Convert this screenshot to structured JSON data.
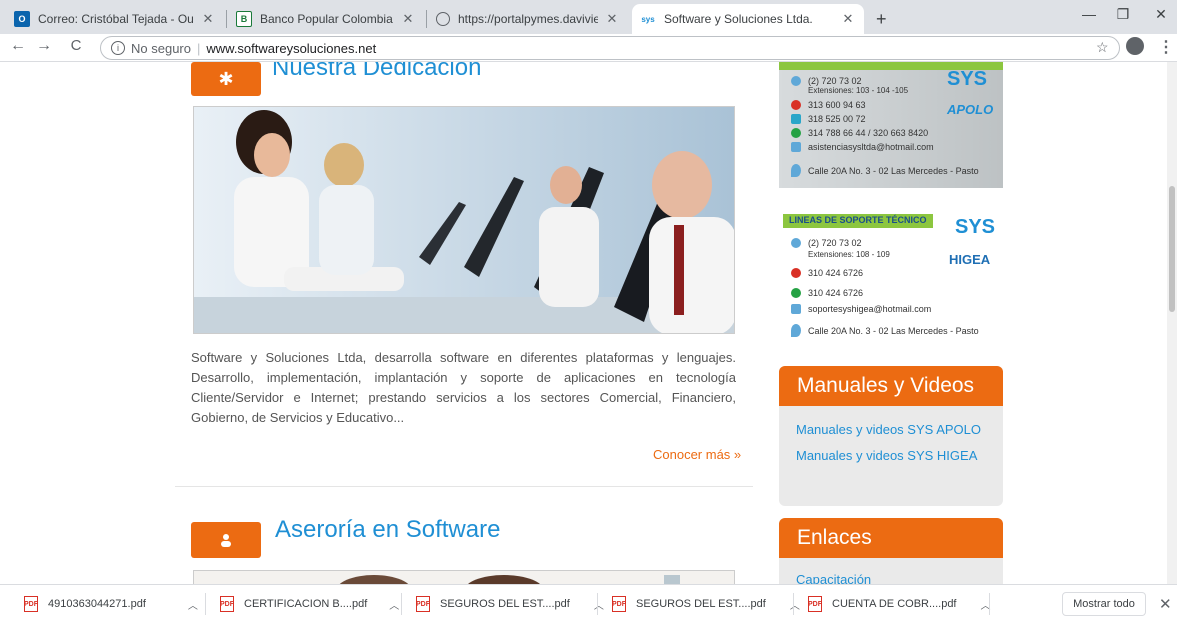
{
  "tabs": [
    {
      "title": "Correo: Cristóbal Tejada - Outloo",
      "favicon": "outlook-icon"
    },
    {
      "title": "Banco Popular Colombia",
      "favicon": "banco-popular-icon"
    },
    {
      "title": "https://portalpymes.davivienda.c",
      "favicon": "globe-icon"
    },
    {
      "title": "Software y Soluciones Ltda.",
      "favicon": "sys-icon"
    }
  ],
  "omnibox": {
    "security": "No seguro",
    "separator": "|",
    "url": "www.softwareysoluciones.net"
  },
  "main": {
    "section1_title": "Nuestra Dedicacion",
    "description": "Software y Soluciones Ltda, desarrolla software en diferentes plataformas y lenguajes. Desarrollo, implementación, implantación y soporte de aplicaciones en tecnología Cliente/Servidor e Internet; prestando servicios a los sectores Comercial, Financiero, Gobierno, de Servicios y Educativo...",
    "more_link": "Conocer más »",
    "section2_title": "Aseroría en Software"
  },
  "apolo_card": {
    "lines": [
      "(2) 720 73 02",
      "Extensiones: 103 - 104 -105",
      "313 600 94 63",
      "318 525 00 72",
      "314 788 66 44 / 320 663 8420",
      "asistenciasysltda@hotmail.com",
      "Calle 20A No. 3 - 02 Las Mercedes - Pasto"
    ],
    "logo_text": "SYS",
    "product": "APOLO"
  },
  "higea_card": {
    "header": "LINEAS DE SOPORTE TÉCNICO",
    "lines": [
      "(2) 720 73 02",
      "Extensiones: 108 - 109",
      "310 424 6726",
      "310 424 6726",
      "soportesyshigea@hotmail.com",
      "Calle 20A No. 3 - 02 Las Mercedes - Pasto"
    ],
    "logo_text": "SYS",
    "product": "HIGEA"
  },
  "sidebar": {
    "manuales_title": "Manuales y Videos",
    "manuales_links": [
      "Manuales y videos SYS APOLO",
      "Manuales y videos SYS HIGEA"
    ],
    "enlaces_title": "Enlaces",
    "enlaces_links": [
      "Capacitación"
    ]
  },
  "downloads": [
    {
      "name": "4910363044271.pdf"
    },
    {
      "name": "CERTIFICACION B....pdf"
    },
    {
      "name": "SEGUROS DEL EST....pdf"
    },
    {
      "name": "SEGUROS DEL EST....pdf"
    },
    {
      "name": "CUENTA DE COBR....pdf"
    }
  ],
  "download_bar": {
    "show_all": "Mostrar todo"
  },
  "colors": {
    "accent": "#ec6b12",
    "link": "#1f8fd4",
    "chrome": "#dee1e6"
  }
}
